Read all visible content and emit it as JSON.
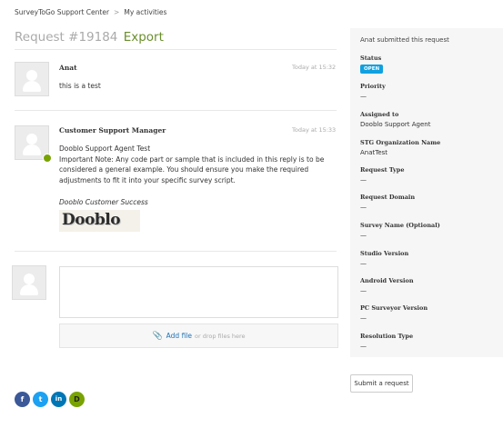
{
  "breadcrumb": {
    "home": "SurveyToGo Support Center",
    "separator": ">",
    "current": "My activities"
  },
  "request": {
    "title": "Request #19184",
    "export_label": "Export"
  },
  "comments": [
    {
      "author": "Anat",
      "time": "Today at 15:32",
      "body": "this is a test"
    },
    {
      "author": "Customer Support Manager",
      "time": "Today at 15:33",
      "lines": [
        "Dooblo Support Agent Test",
        "Important Note: Any code part or sample that is included in this reply is to be",
        "considered a general example. You should ensure you make the required",
        "adjustments to fit it into your specific survey script."
      ],
      "signature": "Dooblo Customer Success",
      "logo_text": "Dooblo"
    }
  ],
  "reply": {
    "add_file": "Add file",
    "drop_hint": "or drop files here"
  },
  "sidebar": {
    "submitted": "Anat submitted this request",
    "status_label": "Status",
    "status_value": "OPEN",
    "fields": [
      {
        "label": "Priority",
        "value": "—"
      },
      {
        "label": "Assigned to",
        "value": "Dooblo Support Agent"
      },
      {
        "label": "STG Organization Name",
        "value": "AnatTest"
      },
      {
        "label": "Request Type",
        "value": "—"
      },
      {
        "label": "Request Domain",
        "value": "—"
      },
      {
        "label": "Survey Name (Optional)",
        "value": "—"
      },
      {
        "label": "Studio Version",
        "value": "—"
      },
      {
        "label": "Android Version",
        "value": "—"
      },
      {
        "label": "PC Surveyor Version",
        "value": "—"
      },
      {
        "label": "Resolution Type",
        "value": "—"
      }
    ]
  },
  "submit_button": "Submit a request",
  "social": {
    "facebook": "f",
    "twitter": "t",
    "linkedin": "in",
    "dooblo": "D"
  },
  "colors": {
    "accent_green": "#6a8f2b",
    "link_blue": "#1f73b7",
    "status_open": "#0fa0e0"
  }
}
